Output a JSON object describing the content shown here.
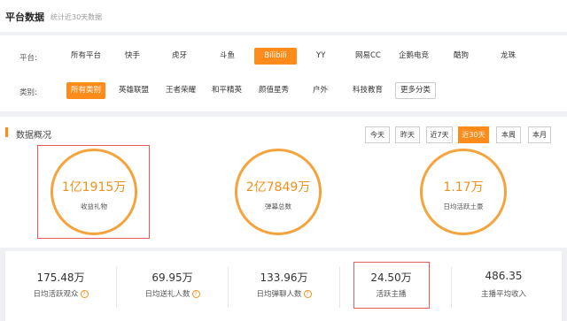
{
  "header": {
    "title": "平台数据",
    "subtitle": "统计近30天数据"
  },
  "platform": {
    "label": "平台:",
    "options": [
      "所有平台",
      "快手",
      "虎牙",
      "斗鱼",
      "Bilibili",
      "YY",
      "网易CC",
      "企鹅电竞",
      "酷狗",
      "龙珠"
    ],
    "selected": "Bilibili"
  },
  "category": {
    "label": "类别:",
    "options": [
      "所有类别",
      "英雄联盟",
      "王者荣耀",
      "和平精英",
      "颜值星秀",
      "户外",
      "科技教育"
    ],
    "more": "更多分类",
    "selected": "所有类别"
  },
  "overview": {
    "title": "数据概况",
    "time_buttons": [
      "今天",
      "昨天",
      "近7天",
      "近30天",
      "本周",
      "本月"
    ],
    "selected_time": "近30天",
    "circles": [
      {
        "value": "1亿1915万",
        "label": "收益礼物"
      },
      {
        "value": "2亿7849万",
        "label": "弹幕总数"
      },
      {
        "value": "1.17万",
        "label": "日均活跃土豪"
      }
    ]
  },
  "stats": [
    {
      "value": "175.48万",
      "label": "日均活跃观众",
      "help": "?"
    },
    {
      "value": "69.95万",
      "label": "日均送礼人数",
      "help": "?"
    },
    {
      "value": "133.96万",
      "label": "日均弹聊人数",
      "help": "?"
    },
    {
      "value": "24.50万",
      "label": "活跃主播"
    },
    {
      "value": "486.35",
      "label": "主播平均收入"
    }
  ],
  "colors": {
    "accent": "#ff8c1a",
    "circle": "#f5a33c",
    "highlight_box": "#e45b5b"
  }
}
